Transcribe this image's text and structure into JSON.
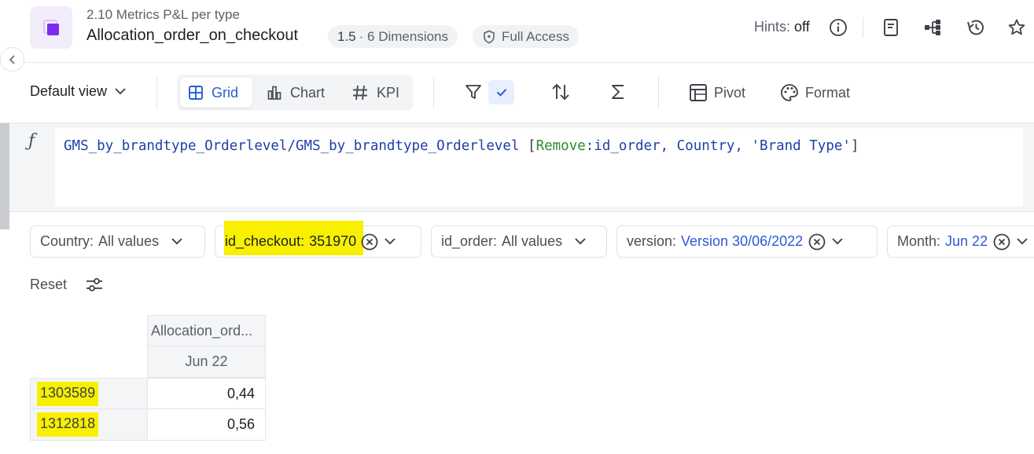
{
  "header": {
    "subtitle": "2.10 Metrics P&L per type",
    "title": "Allocation_order_on_checkout",
    "version": "1.5",
    "dimensions": "· 6 Dimensions",
    "access": "Full Access",
    "hints_label": "Hints:",
    "hints_value": "off",
    "icons": [
      "info-icon",
      "document-icon",
      "hierarchy-icon",
      "history-icon",
      "star-icon"
    ]
  },
  "toolbar": {
    "view": "Default view",
    "tabs": [
      {
        "label": "Grid",
        "icon": "grid-icon",
        "active": true
      },
      {
        "label": "Chart",
        "icon": "bar-chart-icon",
        "active": false
      },
      {
        "label": "KPI",
        "icon": "hash-icon",
        "active": false
      }
    ],
    "pivot": "Pivot",
    "format": "Format"
  },
  "formula": {
    "icon": "function-icon",
    "prefix": "GMS_by_brandtype_Orderlevel/GMS_by_brandtype_Orderlevel ",
    "bracket_open": "[",
    "keyword": "Remove",
    "args": ":id_order, Country, 'Brand Type'",
    "bracket_close": "]"
  },
  "filters": [
    {
      "label": "Country:",
      "value": "All values"
    },
    {
      "label": "id_checkout:",
      "value": "351970"
    },
    {
      "label": "id_order:",
      "value": "All values"
    },
    {
      "label": "version:",
      "value": "Version 30/06/2022"
    },
    {
      "label": "Month:",
      "value": "Jun 22"
    }
  ],
  "reset": "Reset",
  "grid": {
    "column_header": "Allocation_ord...",
    "column_sub": "Jun 22",
    "rows": [
      {
        "label": "1303589",
        "value": "0,44"
      },
      {
        "label": "1312818",
        "value": "0,56"
      }
    ]
  },
  "colors": {
    "accent": "#2a5bd7",
    "highlight": "#f8f000",
    "brand": "#7b2cf0"
  }
}
